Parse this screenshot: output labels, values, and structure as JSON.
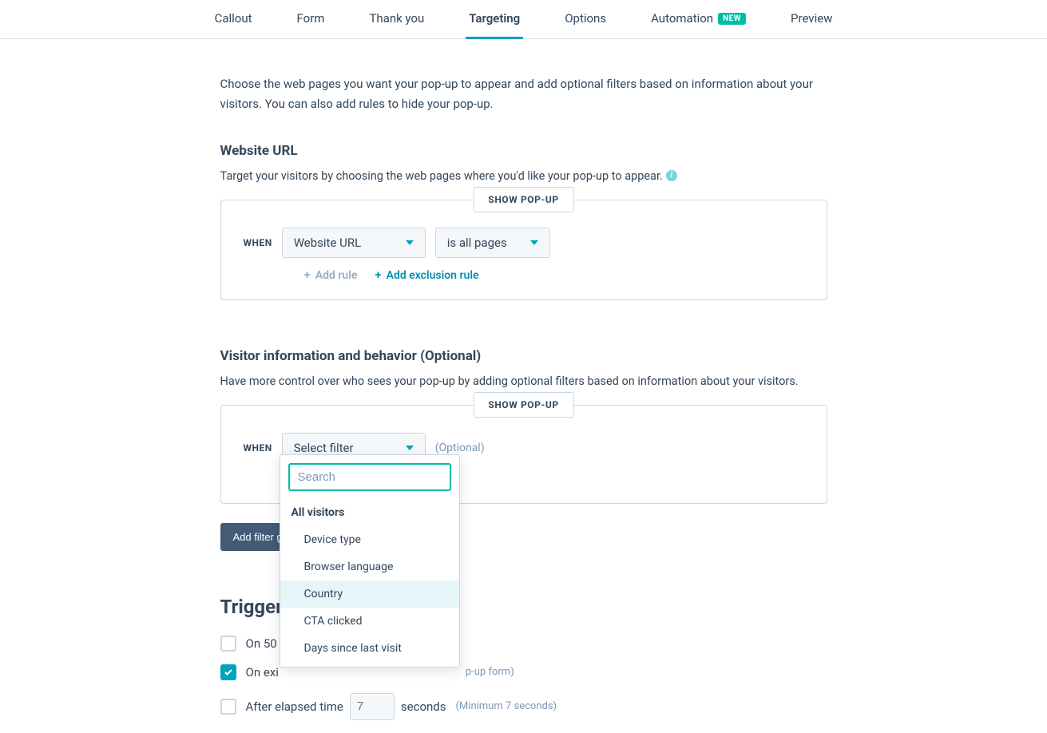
{
  "tabs": {
    "callout": "Callout",
    "form": "Form",
    "thankyou": "Thank you",
    "targeting": "Targeting",
    "options": "Options",
    "automation": "Automation",
    "automation_badge": "NEW",
    "preview": "Preview"
  },
  "intro": "Choose the web pages you want your pop-up to appear and add optional filters based on information about your visitors. You can also add rules to hide your pop-up.",
  "url_section": {
    "title": "Website URL",
    "subtitle": "Target your visitors by choosing the web pages where you'd like your pop-up to appear.",
    "legend": "SHOW POP-UP",
    "when": "WHEN",
    "select1": "Website URL",
    "select2": "is all pages",
    "add_rule": "Add rule",
    "add_exclusion": "Add exclusion rule"
  },
  "visitor_section": {
    "title": "Visitor information and behavior (Optional)",
    "subtitle": "Have more control over who sees your pop-up by adding optional filters based on information about your visitors.",
    "legend": "SHOW POP-UP",
    "when": "WHEN",
    "select_placeholder": "Select filter",
    "optional_hint": "(Optional)",
    "add_filter_group": "Add filter group"
  },
  "filter_dropdown": {
    "search_placeholder": "Search",
    "header": "All visitors",
    "items": {
      "device": "Device type",
      "browser": "Browser language",
      "country": "Country",
      "cta": "CTA clicked",
      "days": "Days since last visit"
    }
  },
  "triggers": {
    "title": "Triggers",
    "on_scroll": "On 50",
    "on_exit": "On exi",
    "on_exit_hint": "p-up form)",
    "after_time": "After elapsed time",
    "seconds": "seconds",
    "min_hint": "(Minimum 7 seconds)",
    "time_input": "7"
  }
}
